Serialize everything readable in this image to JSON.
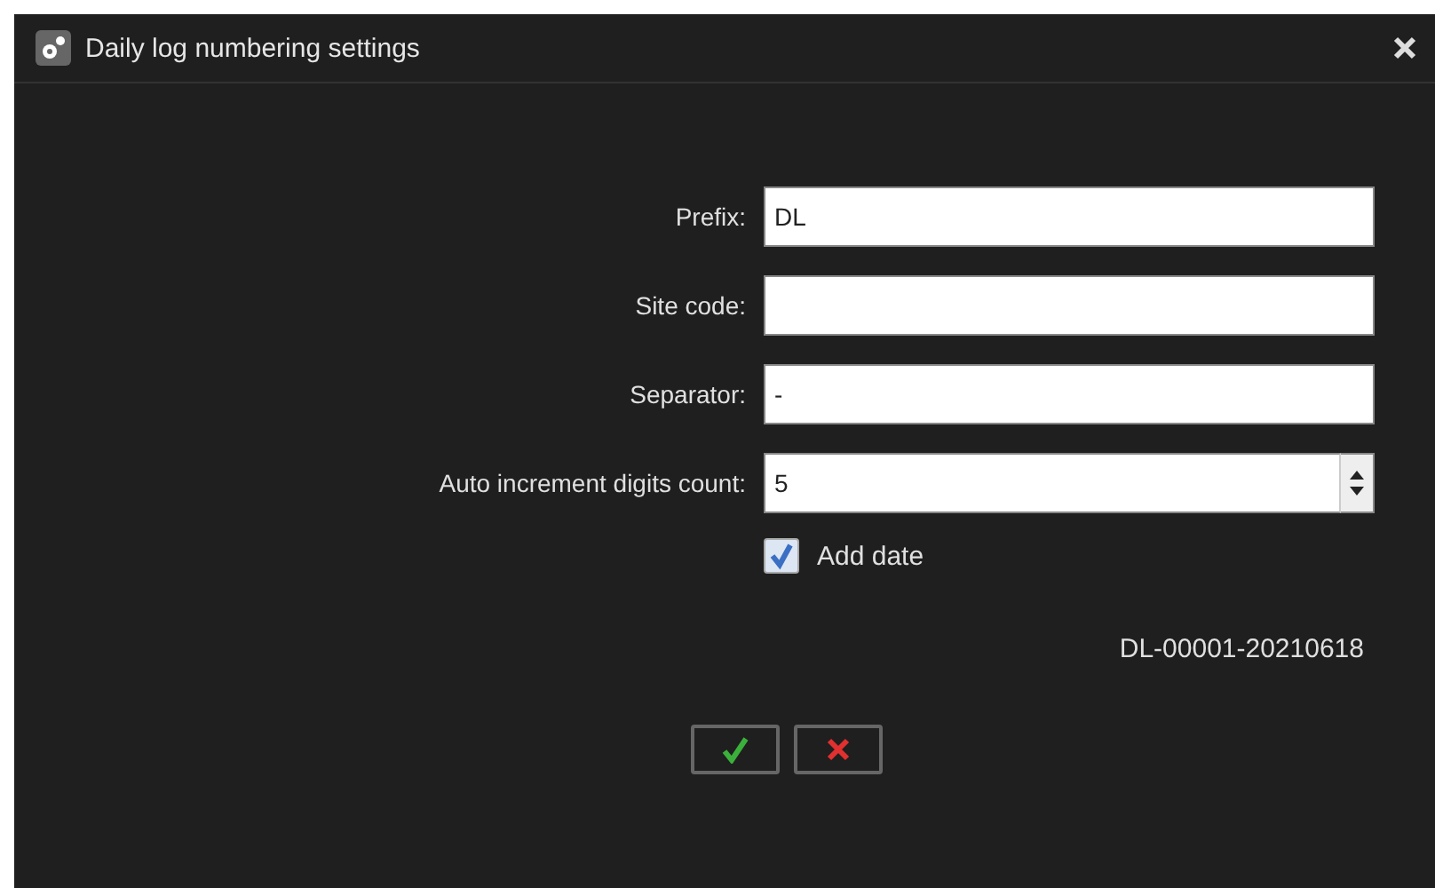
{
  "window": {
    "title": "Daily log numbering settings"
  },
  "fields": [
    {
      "label": "Prefix:",
      "value": "DL",
      "kind": "text"
    },
    {
      "label": "Site code:",
      "kind": "text"
    },
    {
      "label": "Separator:",
      "value": "-",
      "kind": "text"
    },
    {
      "label": "Auto increment digits count:",
      "value": "5",
      "kind": "spin"
    }
  ],
  "add_date": {
    "label": "Add date",
    "checked": true
  },
  "preview": "DL-00001-20210618"
}
